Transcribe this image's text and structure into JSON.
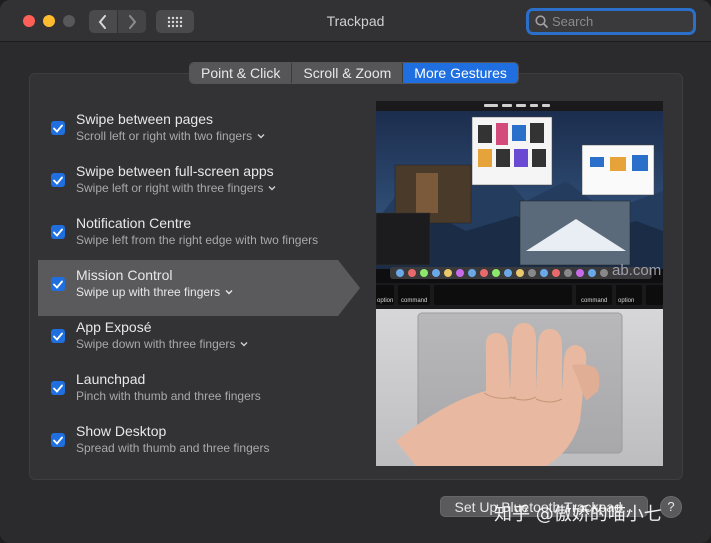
{
  "window": {
    "title": "Trackpad"
  },
  "search": {
    "placeholder": "Search"
  },
  "tabs": [
    {
      "label": "Point & Click",
      "active": false
    },
    {
      "label": "Scroll & Zoom",
      "active": false
    },
    {
      "label": "More Gestures",
      "active": true
    }
  ],
  "gestures": [
    {
      "title": "Swipe between pages",
      "subtitle": "Scroll left or right with two fingers",
      "has_dropdown": true,
      "checked": true,
      "selected": false
    },
    {
      "title": "Swipe between full-screen apps",
      "subtitle": "Swipe left or right with three fingers",
      "has_dropdown": true,
      "checked": true,
      "selected": false
    },
    {
      "title": "Notification Centre",
      "subtitle": "Swipe left from the right edge with two fingers",
      "has_dropdown": false,
      "checked": true,
      "selected": false
    },
    {
      "title": "Mission Control",
      "subtitle": "Swipe up with three fingers",
      "has_dropdown": true,
      "checked": true,
      "selected": true
    },
    {
      "title": "App Exposé",
      "subtitle": "Swipe down with three fingers",
      "has_dropdown": true,
      "checked": true,
      "selected": false
    },
    {
      "title": "Launchpad",
      "subtitle": "Pinch with thumb and three fingers",
      "has_dropdown": false,
      "checked": true,
      "selected": false
    },
    {
      "title": "Show Desktop",
      "subtitle": "Spread with thumb and three fingers",
      "has_dropdown": false,
      "checked": true,
      "selected": false
    }
  ],
  "preview": {
    "keys": [
      "option",
      "command",
      "command",
      "option"
    ],
    "overlay_text": "ab.com"
  },
  "footer": {
    "setup_label": "Set Up Bluetooth Trackpad...",
    "help_label": "?",
    "watermark": "知乎 @傲娇的喵小七"
  },
  "colors": {
    "accent": "#1f6fe0",
    "background": "#2b2b2d",
    "panel": "#333335",
    "selection": "#5a5a5c"
  }
}
